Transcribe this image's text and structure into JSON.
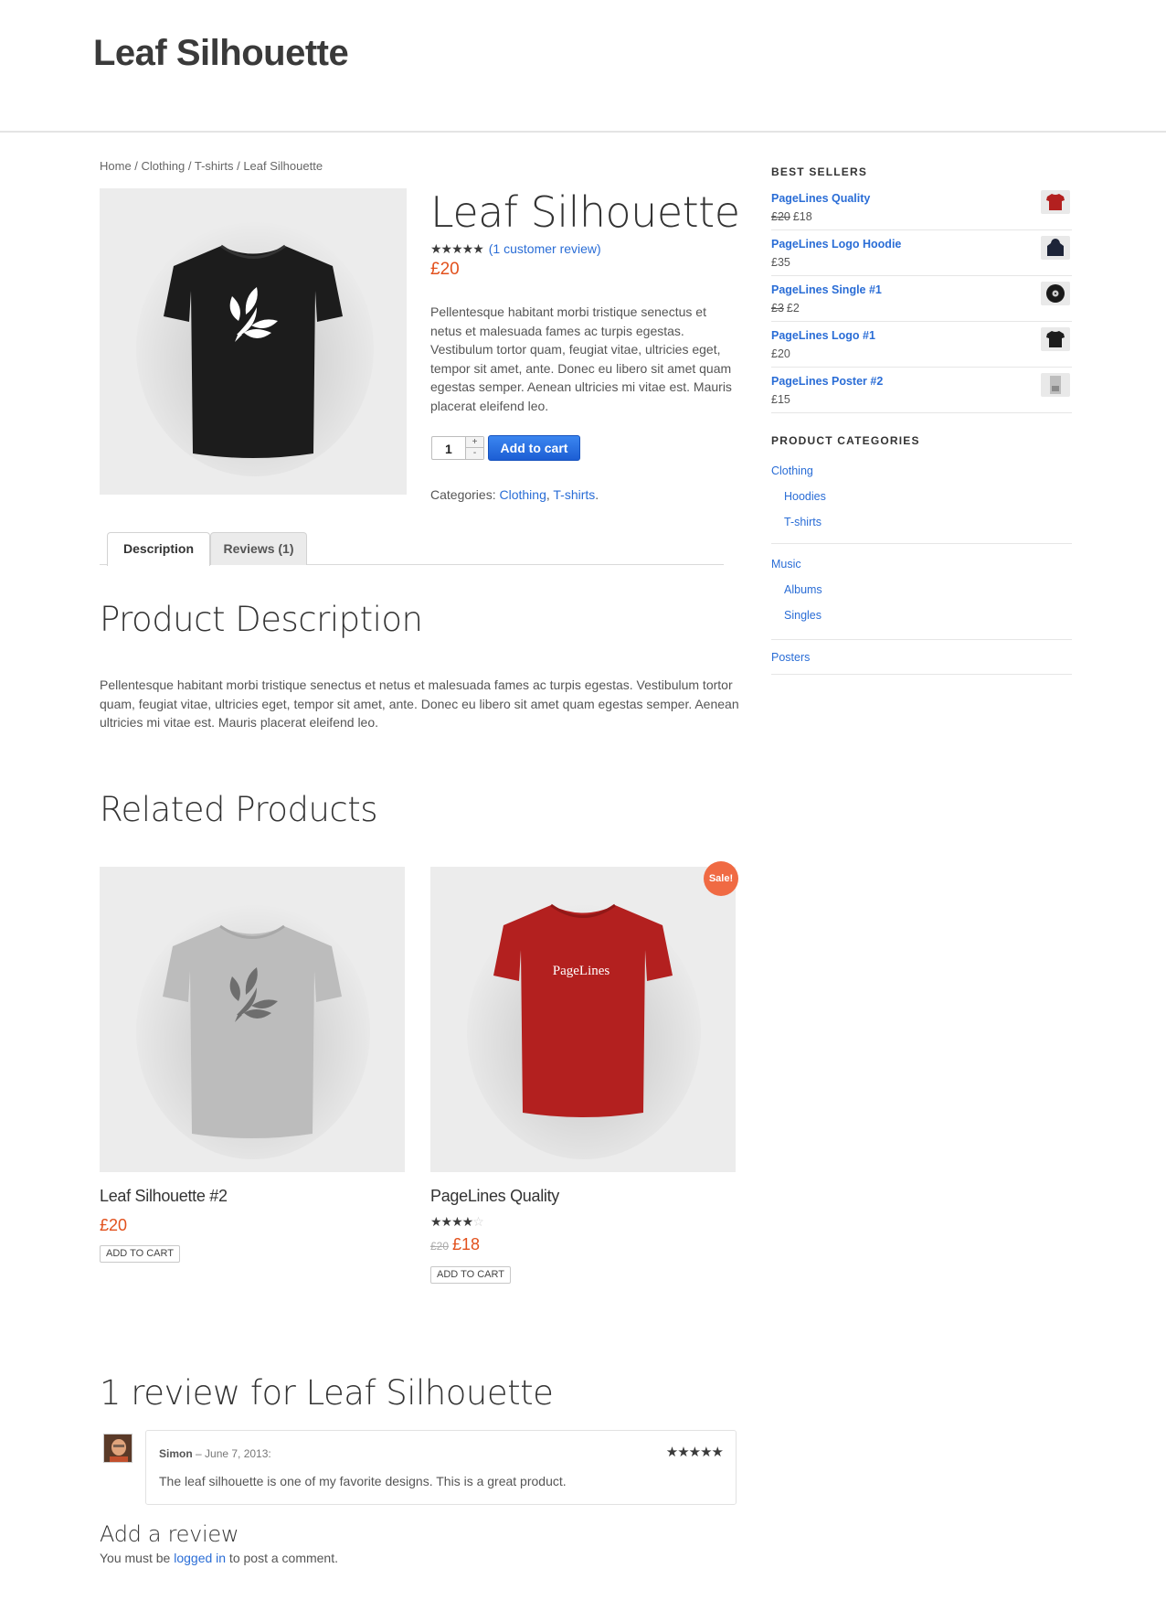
{
  "site": {
    "title": "Leaf Silhouette"
  },
  "breadcrumb": {
    "home": "Home",
    "sep": " / ",
    "clothing": "Clothing",
    "tshirts": "T-shirts",
    "current": "Leaf Silhouette"
  },
  "product": {
    "title": "Leaf Silhouette",
    "stars": "★★★★★",
    "review_link": "(1 customer review)",
    "price": "£20",
    "description": "Pellentesque habitant morbi tristique senectus et netus et malesuada fames ac turpis egestas. Vestibulum tortor quam, feugiat vitae, ultricies eget, tempor sit amet, ante. Donec eu libero sit amet quam egestas semper. Aenean ultricies mi vitae est. Mauris placerat eleifend leo.",
    "quantity": "1",
    "qty_plus": "+",
    "qty_minus": "-",
    "add_to_cart": "Add to cart",
    "categories_label": "Categories:",
    "categories": [
      "Clothing",
      "T-shirts"
    ],
    "shirt_color": "#1c1c1c"
  },
  "tabs": [
    {
      "label": "Description",
      "active": true
    },
    {
      "label": "Reviews (1)",
      "active": false
    }
  ],
  "description_section": {
    "heading": "Product Description",
    "text": "Pellentesque habitant morbi tristique senectus et netus et malesuada fames ac turpis egestas. Vestibulum tortor quam, feugiat vitae, ultricies eget, tempor sit amet, ante. Donec eu libero sit amet quam egestas semper. Aenean ultricies mi vitae est. Mauris placerat eleifend leo."
  },
  "related": {
    "heading": "Related Products",
    "items": [
      {
        "name": "Leaf Silhouette #2",
        "price": "£20",
        "button": "ADD TO CART",
        "shirt_color": "#b9b9b9"
      },
      {
        "name": "PageLines Quality",
        "old_price": "£20",
        "price": "£18",
        "stars": "★★★★",
        "empty_star": "☆",
        "button": "ADD TO CART",
        "badge": "Sale!",
        "shirt_text": "PageLines",
        "shirt_color": "#b3201f"
      }
    ]
  },
  "reviews": {
    "heading": "1 review for Leaf Silhouette",
    "items": [
      {
        "author": "Simon",
        "date": " – June 7, 2013:",
        "stars": "★★★★★",
        "text": "The leaf silhouette is one of my favorite designs. This is a great product."
      }
    ],
    "add_heading": "Add a review",
    "login_prefix": "You must be ",
    "login_link": "logged in",
    "login_suffix": " to post a comment."
  },
  "sidebar": {
    "best_sellers_title": "BEST SELLERS",
    "best_sellers": [
      {
        "name": "PageLines Quality",
        "old_price": "£20",
        "price": "£18",
        "thumb": "red-tshirt"
      },
      {
        "name": "PageLines Logo Hoodie",
        "price": "£35",
        "thumb": "navy-hoodie"
      },
      {
        "name": "PageLines Single #1",
        "old_price": "£3",
        "price": "£2",
        "thumb": "vinyl-record"
      },
      {
        "name": "PageLines Logo #1",
        "price": "£20",
        "thumb": "black-tshirt"
      },
      {
        "name": "PageLines Poster #2",
        "price": "£15",
        "thumb": "poster"
      }
    ],
    "categories_title": "PRODUCT CATEGORIES",
    "categories": [
      {
        "name": "Clothing",
        "children": [
          "Hoodies",
          "T-shirts"
        ]
      },
      {
        "name": "Music",
        "children": [
          "Albums",
          "Singles"
        ]
      },
      {
        "name": "Posters",
        "children": []
      }
    ]
  }
}
